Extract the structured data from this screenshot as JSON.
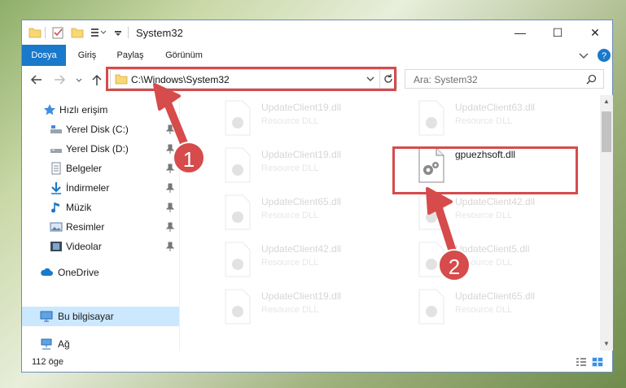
{
  "window": {
    "title": "System32",
    "controls": {
      "minimize": "—",
      "maximize": "☐",
      "close": "✕"
    }
  },
  "ribbon": {
    "tabs": [
      {
        "label": "Dosya",
        "active": true
      },
      {
        "label": "Giriş",
        "active": false
      },
      {
        "label": "Paylaş",
        "active": false
      },
      {
        "label": "Görünüm",
        "active": false
      }
    ]
  },
  "address": {
    "path": "C:\\Windows\\System32",
    "search_placeholder": "Ara: System32"
  },
  "nav": {
    "quick_access": "Hızlı erişim",
    "items": [
      {
        "label": "Yerel Disk (C:)",
        "icon": "drive-icon"
      },
      {
        "label": "Yerel Disk (D:)",
        "icon": "drive-icon"
      },
      {
        "label": "Belgeler",
        "icon": "documents-icon"
      },
      {
        "label": "İndirmeler",
        "icon": "downloads-icon"
      },
      {
        "label": "Müzik",
        "icon": "music-icon"
      },
      {
        "label": "Resimler",
        "icon": "pictures-icon"
      },
      {
        "label": "Videolar",
        "icon": "videos-icon"
      }
    ],
    "onedrive": "OneDrive",
    "this_pc": "Bu bilgisayar",
    "network": "Ağ"
  },
  "files": [
    {
      "name": "UpdateClient19.dll",
      "type": "Resource DLL",
      "faded": true
    },
    {
      "name": "UpdateClient63.dll",
      "type": "Resource DLL",
      "faded": true
    },
    {
      "name": "UpdateClient19.dll",
      "type": "Resource DLL",
      "faded": true
    },
    {
      "name": "gpuezhsoft.dll",
      "type": "",
      "faded": false
    },
    {
      "name": "UpdateClient65.dll",
      "type": "Resource DLL",
      "faded": true
    },
    {
      "name": "UpdateClient42.dll",
      "type": "Resource DLL",
      "faded": true
    },
    {
      "name": "UpdateClient42.dll",
      "type": "Resource DLL",
      "faded": true
    },
    {
      "name": "UpdateClient5.dll",
      "type": "Resource DLL",
      "faded": true
    },
    {
      "name": "UpdateClient19.dll",
      "type": "Resource DLL",
      "faded": true
    },
    {
      "name": "UpdateClient65.dll",
      "type": "Resource DLL",
      "faded": true
    }
  ],
  "status": {
    "count": "112 öge"
  },
  "annotations": {
    "step1": "1",
    "step2": "2",
    "color": "#d64b4b"
  },
  "colors": {
    "accent": "#1979ca",
    "selection": "#cce8ff"
  }
}
